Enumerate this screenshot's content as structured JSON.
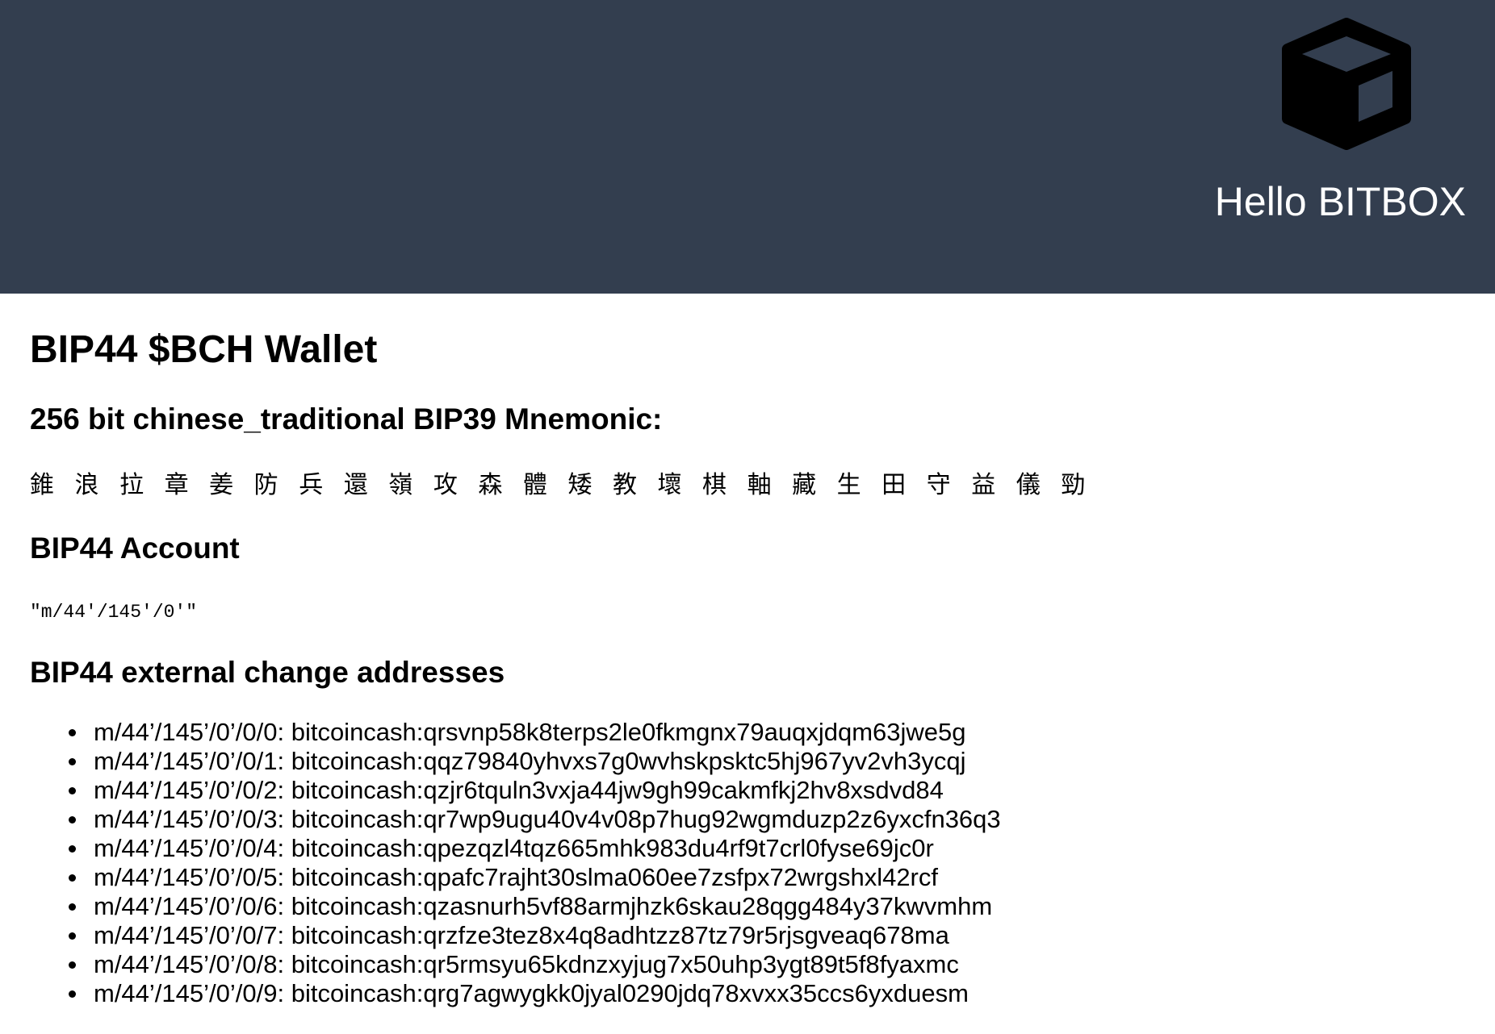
{
  "header": {
    "logo_icon": "cube-icon",
    "hello_text": "Hello BITBOX",
    "background_color": "#333e4f",
    "text_color": "#ffffff"
  },
  "main": {
    "title": "BIP44 $BCH Wallet",
    "mnemonic_label": "256 bit chinese_traditional BIP39 Mnemonic:",
    "mnemonic": "錐 浪 拉 章 姜 防 兵 還 嶺 攻 森 體 矮 教 壞 棋 軸 藏 生 田 守 益 儀 勁",
    "account_label": "BIP44 Account",
    "account_path": "\"m/44'/145'/0'\"",
    "addresses_label": "BIP44 external change addresses",
    "addresses": [
      "m/44’/145’/0’/0/0: bitcoincash:qrsvnp58k8terps2le0fkmgnx79auqxjdqm63jwe5g",
      "m/44’/145’/0’/0/1: bitcoincash:qqz79840yhvxs7g0wvhskpsktc5hj967yv2vh3ycqj",
      "m/44’/145’/0’/0/2: bitcoincash:qzjr6tquln3vxja44jw9gh99cakmfkj2hv8xsdvd84",
      "m/44’/145’/0’/0/3: bitcoincash:qr7wp9ugu40v4v08p7hug92wgmduzp2z6yxcfn36q3",
      "m/44’/145’/0’/0/4: bitcoincash:qpezqzl4tqz665mhk983du4rf9t7crl0fyse69jc0r",
      "m/44’/145’/0’/0/5: bitcoincash:qpafc7rajht30slma060ee7zsfpx72wrgshxl42rcf",
      "m/44’/145’/0’/0/6: bitcoincash:qzasnurh5vf88armjhzk6skau28qgg484y37kwvmhm",
      "m/44’/145’/0’/0/7: bitcoincash:qrzfze3tez8x4q8adhtzz87tz79r5rjsgveaq678ma",
      "m/44’/145’/0’/0/8: bitcoincash:qr5rmsyu65kdnzxyjug7x50uhp3ygt89t5f8fyaxmc",
      "m/44’/145’/0’/0/9: bitcoincash:qrg7agwygkk0jyal0290jdq78xvxx35ccs6yxduesm"
    ]
  }
}
